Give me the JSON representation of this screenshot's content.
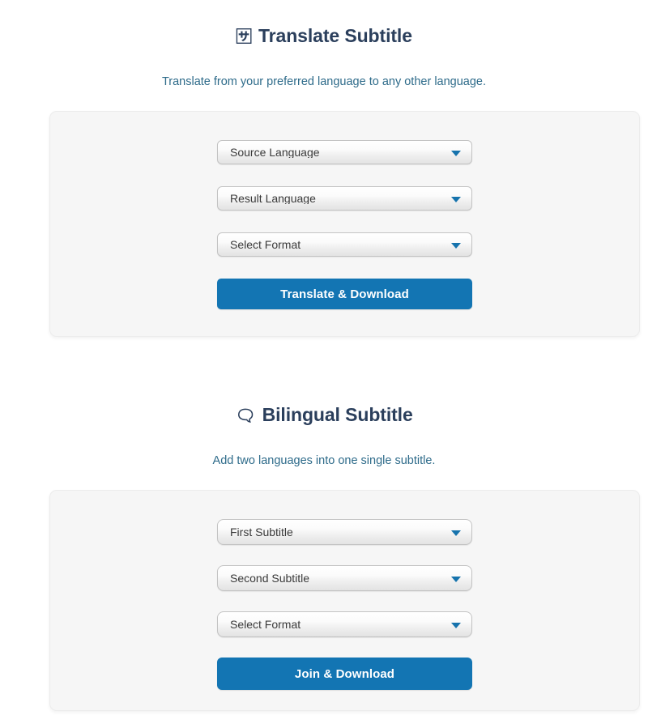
{
  "page": {
    "background": "#ffffff",
    "accent_blue": "#1375b3",
    "title_color": "#2b3f5c",
    "subtitle_color": "#2e6b8a",
    "card_background": "#f6f6f6"
  },
  "sections": [
    {
      "id": "translate-subtitle",
      "icon": "🈂",
      "icon_name": "translate-icon",
      "title": "Translate Subtitle",
      "subtitle": "Translate from your preferred language to any other language.",
      "selects": [
        {
          "name": "source-language-select",
          "value": "Source Language"
        },
        {
          "name": "result-language-select",
          "value": "Result Language"
        },
        {
          "name": "format-select",
          "value": "Select Format"
        }
      ],
      "button": {
        "name": "translate-download-button",
        "label": "Translate & Download"
      }
    },
    {
      "id": "bilingual-subtitle",
      "icon": "🗨",
      "icon_name": "speech-balloons-icon",
      "title": "Bilingual Subtitle",
      "subtitle": "Add two languages into one single subtitle.",
      "selects": [
        {
          "name": "first-subtitle-select",
          "value": "First Subtitle"
        },
        {
          "name": "second-subtitle-select",
          "value": "Second Subtitle"
        },
        {
          "name": "format-select",
          "value": "Select Format"
        }
      ],
      "button": {
        "name": "join-download-button",
        "label": "Join & Download"
      }
    }
  ]
}
